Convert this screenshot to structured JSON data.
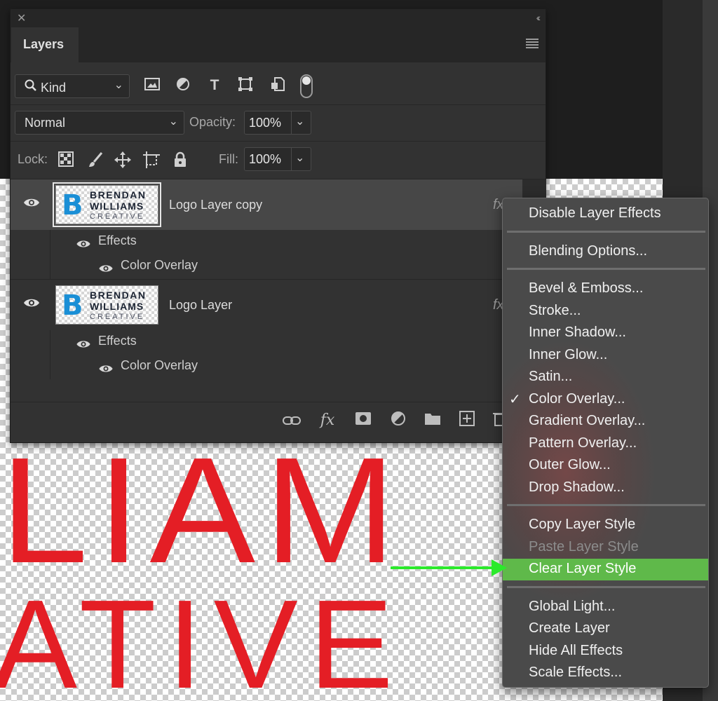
{
  "canvas": {
    "text_line1": "LIAM",
    "text_line2": "ATIVE"
  },
  "panel": {
    "close_icon": "✕",
    "collapse_icon": "‹‹",
    "tab_label": "Layers",
    "filter": {
      "kind_label": "Kind",
      "icons": [
        "image-filter-icon",
        "adjustment-filter-icon",
        "type-filter-icon",
        "shape-filter-icon",
        "smart-object-filter-icon"
      ]
    },
    "blend": {
      "mode": "Normal",
      "opacity_label": "Opacity:",
      "opacity_value": "100%"
    },
    "lock": {
      "label": "Lock:",
      "fill_label": "Fill:",
      "fill_value": "100%"
    },
    "layers": [
      {
        "name": "Logo Layer copy",
        "selected": true,
        "thumb": {
          "line1": "BRENDAN",
          "line2": "WILLIAMS",
          "line3": "CREATIVE"
        },
        "effects_label": "Effects",
        "effect": "Color Overlay"
      },
      {
        "name": "Logo Layer",
        "selected": false,
        "thumb": {
          "line1": "BRENDAN",
          "line2": "WILLIAMS",
          "line3": "CREATIVE"
        },
        "effects_label": "Effects",
        "effect": "Color Overlay"
      }
    ],
    "fx_mark": "fx"
  },
  "context_menu": {
    "groups": [
      [
        {
          "label": "Disable Layer Effects"
        }
      ],
      [
        {
          "label": "Blending Options..."
        }
      ],
      [
        {
          "label": "Bevel & Emboss..."
        },
        {
          "label": "Stroke..."
        },
        {
          "label": "Inner Shadow..."
        },
        {
          "label": "Inner Glow..."
        },
        {
          "label": "Satin..."
        },
        {
          "label": "Color Overlay...",
          "checked": true
        },
        {
          "label": "Gradient Overlay..."
        },
        {
          "label": "Pattern Overlay..."
        },
        {
          "label": "Outer Glow..."
        },
        {
          "label": "Drop Shadow..."
        }
      ],
      [
        {
          "label": "Copy Layer Style"
        },
        {
          "label": "Paste Layer Style",
          "disabled": true
        },
        {
          "label": "Clear Layer Style",
          "highlighted": true
        }
      ],
      [
        {
          "label": "Global Light..."
        },
        {
          "label": "Create Layer"
        },
        {
          "label": "Hide All Effects"
        },
        {
          "label": "Scale Effects..."
        }
      ]
    ]
  },
  "colors": {
    "highlight": "#5fb94a",
    "arrow": "#2bea2b",
    "logo_red": "#e41e25",
    "logo_blue": "#1a8fd6"
  }
}
